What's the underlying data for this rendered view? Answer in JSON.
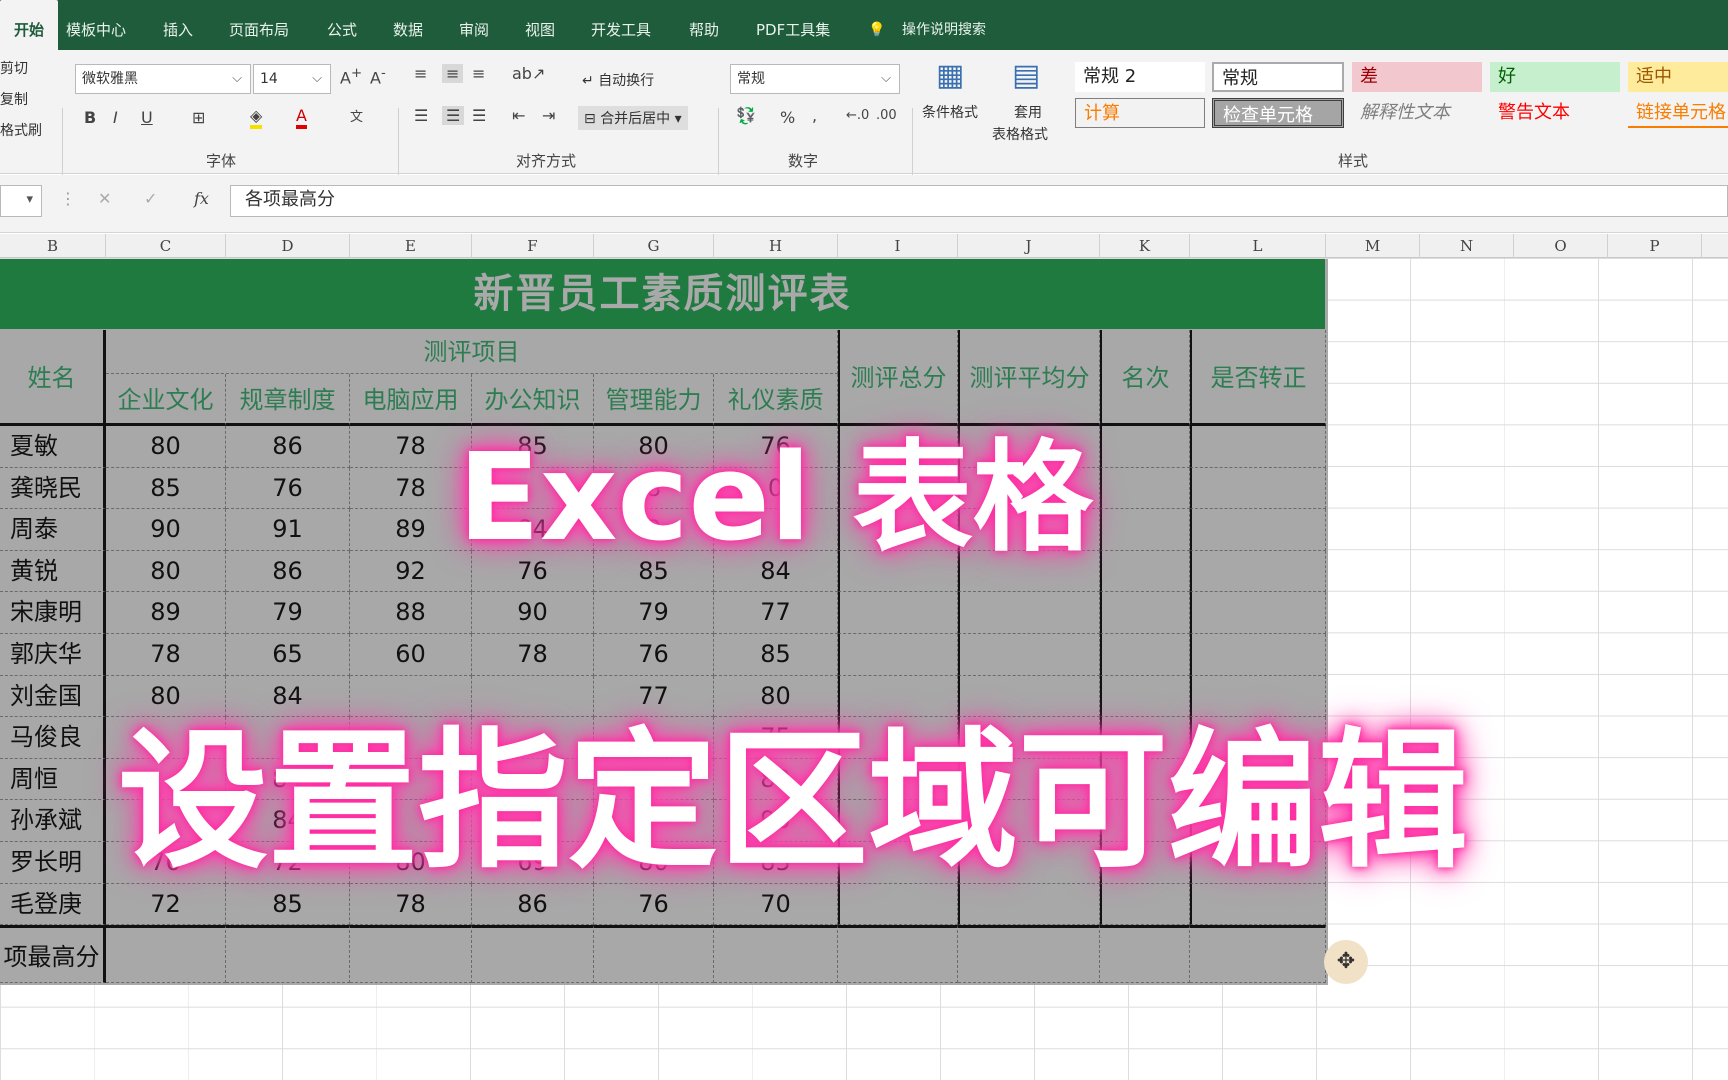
{
  "tabs": [
    "开始",
    "模板中心",
    "插入",
    "页面布局",
    "公式",
    "数据",
    "审阅",
    "视图",
    "开发工具",
    "帮助",
    "PDF工具集",
    "操作说明搜索"
  ],
  "clipboard": {
    "cut": "剪切",
    "copy": "复制",
    "format_painter": "格式刷"
  },
  "font": {
    "name": "微软雅黑",
    "size": "14",
    "group_label": "字体"
  },
  "align": {
    "wrap": "自动换行",
    "merge": "合并后居中",
    "group_label": "对齐方式"
  },
  "number": {
    "format": "常规",
    "percent": "%",
    "comma": ",",
    "group_label": "数字"
  },
  "styles": {
    "conditional": "条件格式",
    "table_fmt_1": "套用",
    "table_fmt_2": "表格格式",
    "group_label": "样式",
    "items": [
      {
        "label": "常规 2",
        "bg": "#ffffff",
        "fg": "#222222"
      },
      {
        "label": "常规",
        "bg": "#ffffff",
        "fg": "#222222"
      },
      {
        "label": "差",
        "bg": "#f3c7ce",
        "fg": "#9c0006"
      },
      {
        "label": "好",
        "bg": "#c6efce",
        "fg": "#006100"
      },
      {
        "label": "适中",
        "bg": "#ffeb9c",
        "fg": "#9c5700"
      },
      {
        "label": "计算",
        "bg": "#f2f2f2",
        "fg": "#fa7d00"
      },
      {
        "label": "检查单元格",
        "bg": "#a5a5a5",
        "fg": "#ffffff"
      },
      {
        "label": "解释性文本",
        "bg": "#f3f3f3",
        "fg": "#7f7f7f"
      },
      {
        "label": "警告文本",
        "bg": "#f3f3f3",
        "fg": "#ff0000"
      },
      {
        "label": "链接单元格",
        "bg": "#f3f3f3",
        "fg": "#fa7d00"
      }
    ]
  },
  "formula_bar": {
    "fx": "fx",
    "content": "各项最高分"
  },
  "columns": [
    "B",
    "C",
    "D",
    "E",
    "F",
    "G",
    "H",
    "I",
    "J",
    "K",
    "L",
    "M",
    "N",
    "O",
    "P"
  ],
  "sheet": {
    "title": "新晋员工素质测评表",
    "name_header": "姓名",
    "group_header": "测评项目",
    "sub_headers": [
      "企业文化",
      "规章制度",
      "电脑应用",
      "办公知识",
      "管理能力",
      "礼仪素质"
    ],
    "extra_headers": [
      "测评总分",
      "测评平均分",
      "名次",
      "是否转正"
    ],
    "rows": [
      {
        "name": "夏敏",
        "scores": [
          "80",
          "86",
          "78",
          "85",
          "80",
          "76"
        ]
      },
      {
        "name": "龚晓民",
        "scores": [
          "85",
          "76",
          "78",
          "",
          "8",
          "0"
        ]
      },
      {
        "name": "周泰",
        "scores": [
          "90",
          "91",
          "89",
          "84",
          "3",
          ""
        ]
      },
      {
        "name": "黄锐",
        "scores": [
          "80",
          "86",
          "92",
          "76",
          "85",
          "84"
        ]
      },
      {
        "name": "宋康明",
        "scores": [
          "89",
          "79",
          "88",
          "90",
          "79",
          "77"
        ]
      },
      {
        "name": "郭庆华",
        "scores": [
          "78",
          "65",
          "60",
          "78",
          "76",
          "85"
        ]
      },
      {
        "name": "刘金国",
        "scores": [
          "80",
          "84",
          "",
          "",
          "77",
          "80"
        ]
      },
      {
        "name": "马俊良",
        "scores": [
          "",
          "",
          "",
          "",
          "",
          "75"
        ]
      },
      {
        "name": "周恒",
        "scores": [
          "",
          "84",
          "",
          "",
          "",
          "89"
        ]
      },
      {
        "name": "孙承斌",
        "scores": [
          "",
          "84",
          "",
          "",
          "",
          "90"
        ]
      },
      {
        "name": "罗长明",
        "scores": [
          "76",
          "72",
          "80",
          "69",
          "80",
          "85"
        ]
      },
      {
        "name": "毛登庚",
        "scores": [
          "72",
          "85",
          "78",
          "86",
          "76",
          "70"
        ]
      }
    ],
    "footer_label": "项最高分"
  },
  "overlay": {
    "line1": "Excel 表格",
    "line2": "设置指定区域可编辑"
  }
}
